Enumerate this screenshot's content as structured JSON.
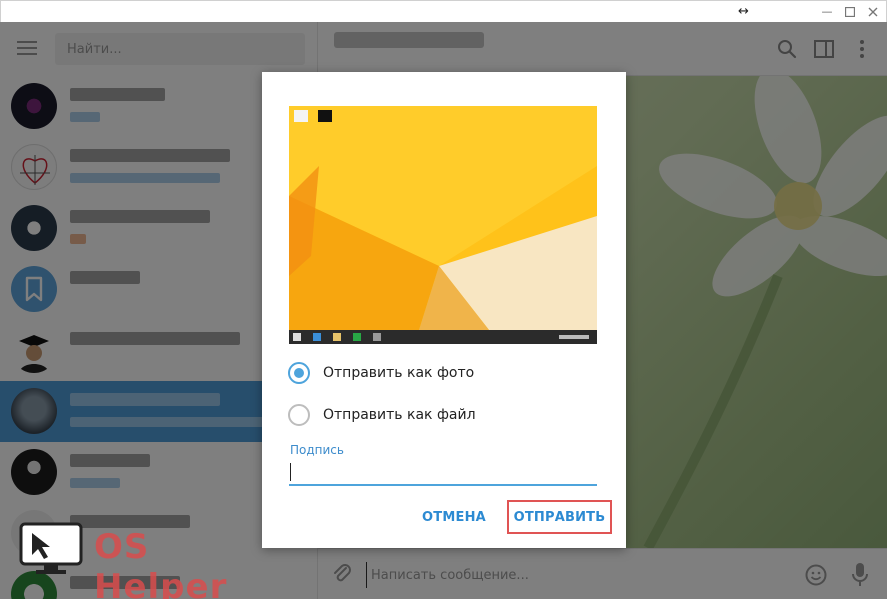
{
  "search": {
    "placeholder": "Найти..."
  },
  "composer": {
    "placeholder": "Написать сообщение..."
  },
  "dialog": {
    "option_photo": "Отправить как фото",
    "option_file": "Отправить как файл",
    "selected_option": "photo",
    "caption_label": "Подпись",
    "caption_value": "",
    "cancel_label": "ОТМЕНА",
    "send_label": "ОТПРАВИТЬ"
  },
  "watermark": {
    "brand": "OS Helper"
  },
  "colors": {
    "accent": "#4ea4dc",
    "active_chat": "#4f9cd9",
    "highlight_box": "#e05454",
    "preview_wallpaper": "#ffbf11"
  },
  "icons": [
    "menu-icon",
    "search-icon",
    "sidebar-toggle-icon",
    "more-vert-icon",
    "attach-icon",
    "emoji-icon",
    "mic-icon",
    "minimize-icon",
    "maximize-icon",
    "close-icon"
  ]
}
